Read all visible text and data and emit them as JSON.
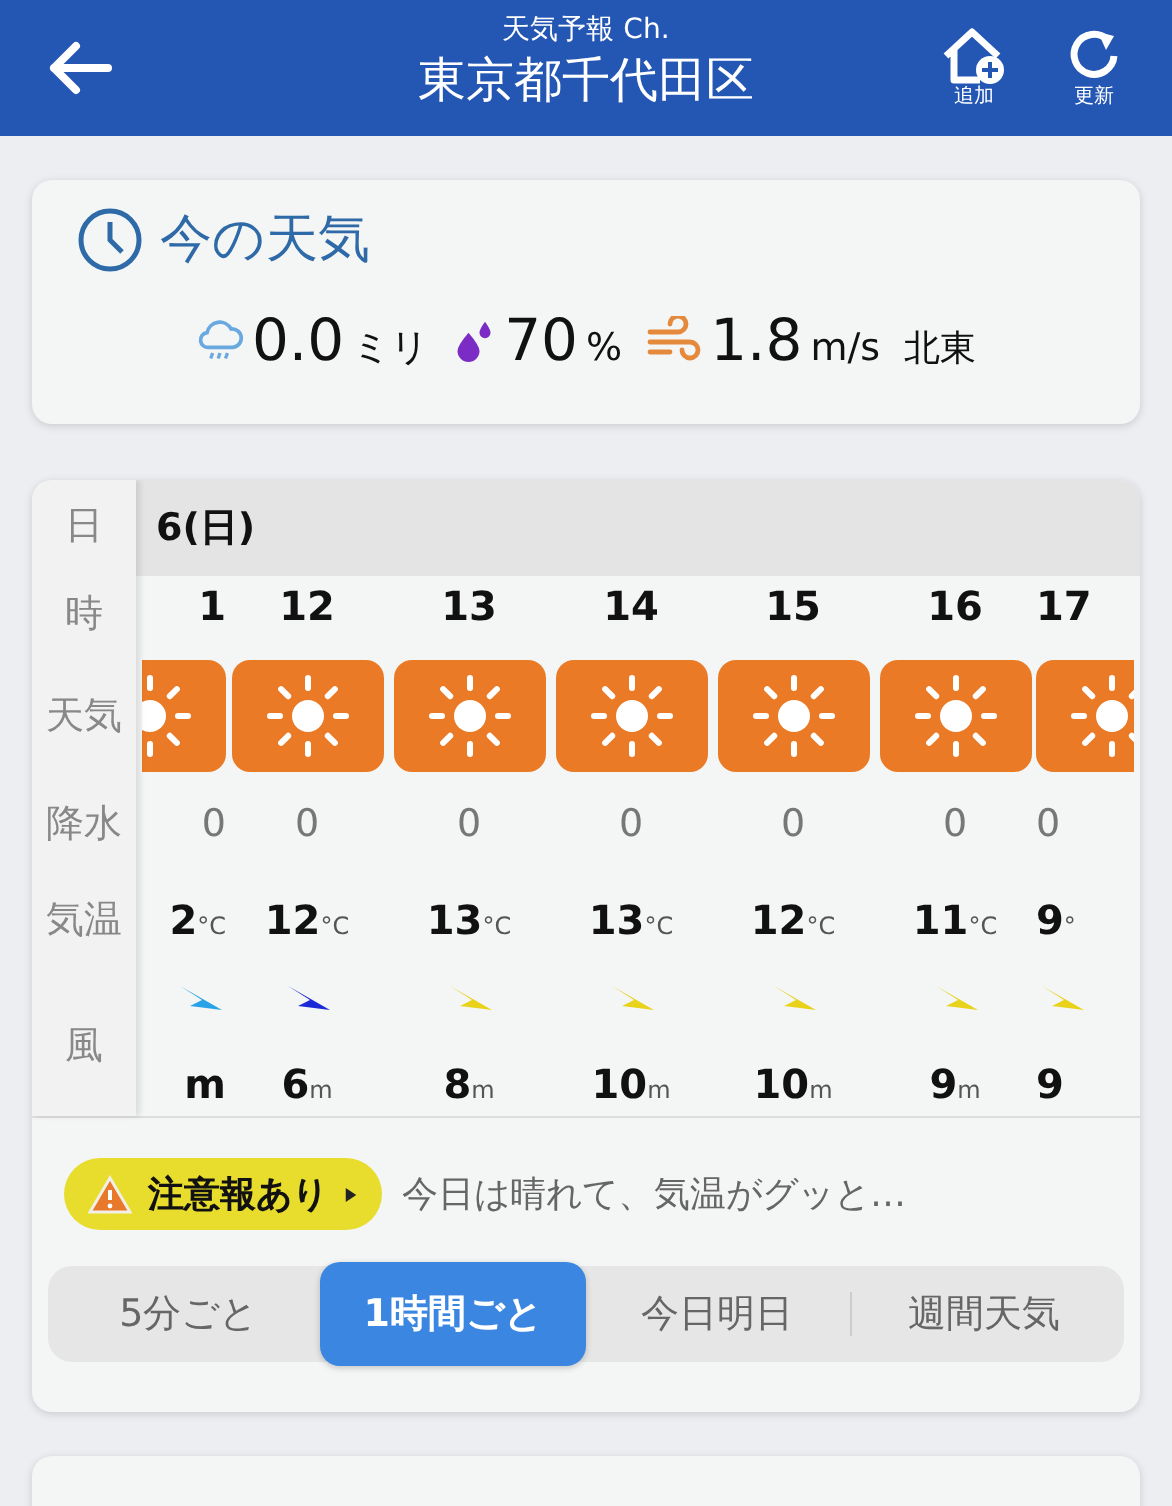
{
  "header": {
    "subtitle": "天気予報 Ch.",
    "title": "東京都千代田区",
    "actions": [
      {
        "kind": "add",
        "label": "追加"
      },
      {
        "kind": "refresh",
        "label": "更新"
      }
    ]
  },
  "current": {
    "title": "今の天気",
    "items": [
      {
        "kind": "rain",
        "value": "0.0",
        "unit": "ミリ"
      },
      {
        "kind": "humidity",
        "value": "70",
        "unit": "%"
      },
      {
        "kind": "wind",
        "value": "1.8",
        "unit": "m/s",
        "extra": "北東"
      }
    ]
  },
  "hourly": {
    "row_labels": [
      "日",
      "時",
      "天気",
      "降水",
      "気温",
      "風"
    ],
    "day": "6(日)",
    "hours": [
      {
        "hour": "1",
        "kind": "sunny",
        "precip": "0",
        "temp": "2",
        "temp_unit": "°C",
        "color": "#29a3e8",
        "wind_speed": "m"
      },
      {
        "hour": "12",
        "kind": "sunny",
        "precip": "0",
        "temp": "12",
        "temp_unit": "°C",
        "color": "#1a2ad6",
        "wind_speed": "6",
        "wind_unit": "m"
      },
      {
        "hour": "13",
        "kind": "sunny",
        "precip": "0",
        "temp": "13",
        "temp_unit": "°C",
        "color": "#e8d21a",
        "wind_speed": "8",
        "wind_unit": "m"
      },
      {
        "hour": "14",
        "kind": "sunny",
        "precip": "0",
        "temp": "13",
        "temp_unit": "°C",
        "color": "#e8d21a",
        "wind_speed": "10",
        "wind_unit": "m"
      },
      {
        "hour": "15",
        "kind": "sunny",
        "precip": "0",
        "temp": "12",
        "temp_unit": "°C",
        "color": "#e8d21a",
        "wind_speed": "10",
        "wind_unit": "m"
      },
      {
        "hour": "16",
        "kind": "sunny",
        "precip": "0",
        "temp": "11",
        "temp_unit": "°C",
        "color": "#e8d21a",
        "wind_speed": "9",
        "wind_unit": "m"
      },
      {
        "hour": "17",
        "kind": "sunny",
        "precip": "0",
        "temp": "9",
        "temp_unit": "°",
        "color": "#e8d21a",
        "wind_speed": "9"
      }
    ]
  },
  "alert": {
    "label": "注意報あり",
    "text": "今日は晴れて、気温がグッと…"
  },
  "tabs": [
    {
      "label": "5分ごと",
      "selected": false
    },
    {
      "label": "1時間ごと",
      "selected": true
    },
    {
      "label": "今日明日",
      "selected": false
    },
    {
      "label": "週間天気",
      "selected": false
    }
  ]
}
